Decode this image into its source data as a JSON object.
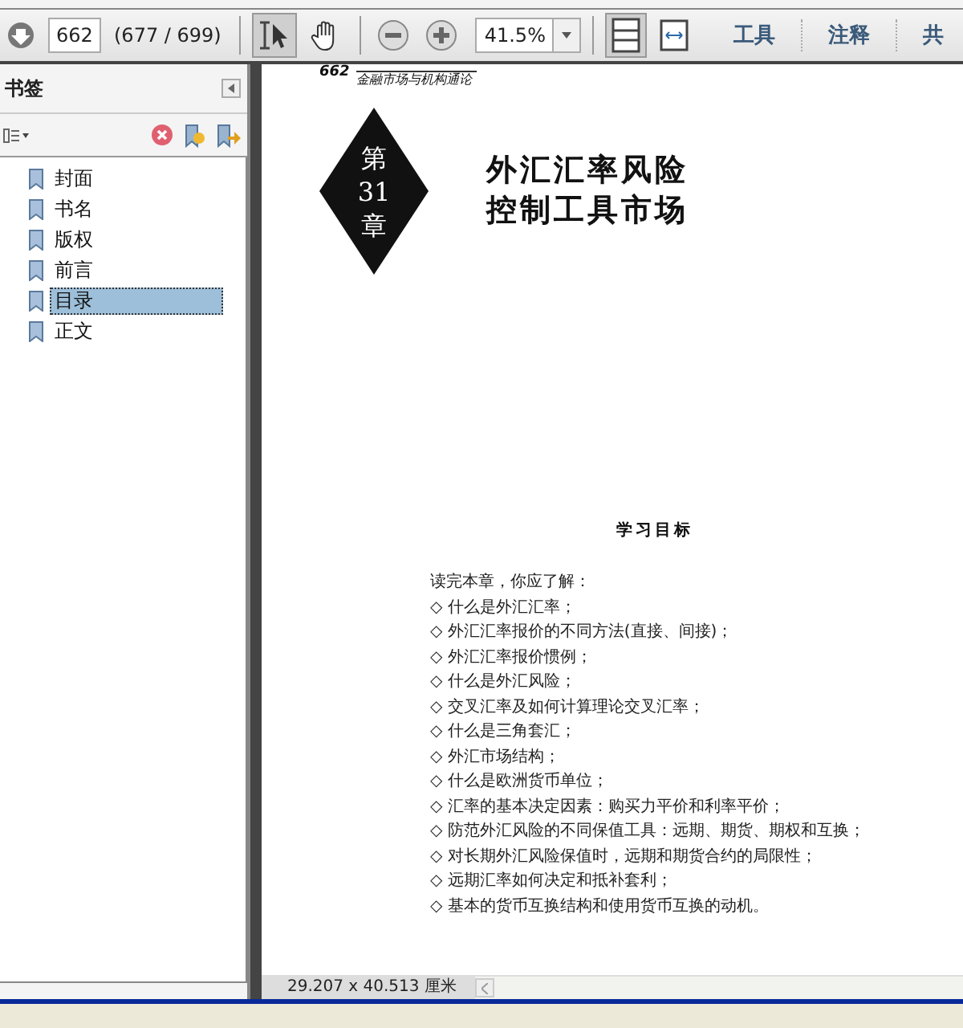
{
  "toolbar": {
    "page_number": "662",
    "page_count": "(677 / 699)",
    "zoom": "41.5%",
    "tools": [
      {
        "kind": "select",
        "selected": true
      },
      {
        "kind": "hand",
        "selected": false
      }
    ],
    "view_modes": [
      {
        "kind": "fit-page",
        "selected": true
      },
      {
        "kind": "fit-width",
        "selected": false
      }
    ],
    "panes": [
      "工具",
      "注释",
      "共"
    ]
  },
  "bookmarks": {
    "title": "书签",
    "items": [
      {
        "label": "封面",
        "selected": false
      },
      {
        "label": "书名",
        "selected": false
      },
      {
        "label": "版权",
        "selected": false
      },
      {
        "label": "前言",
        "selected": false
      },
      {
        "label": "目录",
        "selected": true
      },
      {
        "label": "正文",
        "selected": false
      }
    ]
  },
  "document": {
    "page_header_number": "662",
    "page_header_title": "金融市场与机构通论",
    "chapter_word_1": "第",
    "chapter_number": "31",
    "chapter_word_2": "章",
    "chapter_title_lines": [
      "外汇汇率风险",
      "控制工具市场"
    ],
    "section_title": "学习目标",
    "intro": "读完本章，你应了解：",
    "objectives": [
      "◇ 什么是外汇汇率；",
      "◇ 外汇汇率报价的不同方法(直接、间接)；",
      "◇ 外汇汇率报价惯例；",
      "◇ 什么是外汇风险；",
      "◇ 交叉汇率及如何计算理论交叉汇率；",
      "◇ 什么是三角套汇；",
      "◇ 外汇市场结构；",
      "◇ 什么是欧洲货币单位；",
      "◇ 汇率的基本决定因素：购买力平价和利率平价；",
      "◇ 防范外汇风险的不同保值工具：远期、期货、期权和互换；",
      "◇ 对长期外汇风险保值时，远期和期货合约的局限性；",
      "◇ 远期汇率如何决定和抵补套利；",
      "◇ 基本的货币互换结构和使用货币互换的动机。"
    ]
  },
  "status_bar": {
    "page_size": "29.207 x 40.513 厘米"
  }
}
